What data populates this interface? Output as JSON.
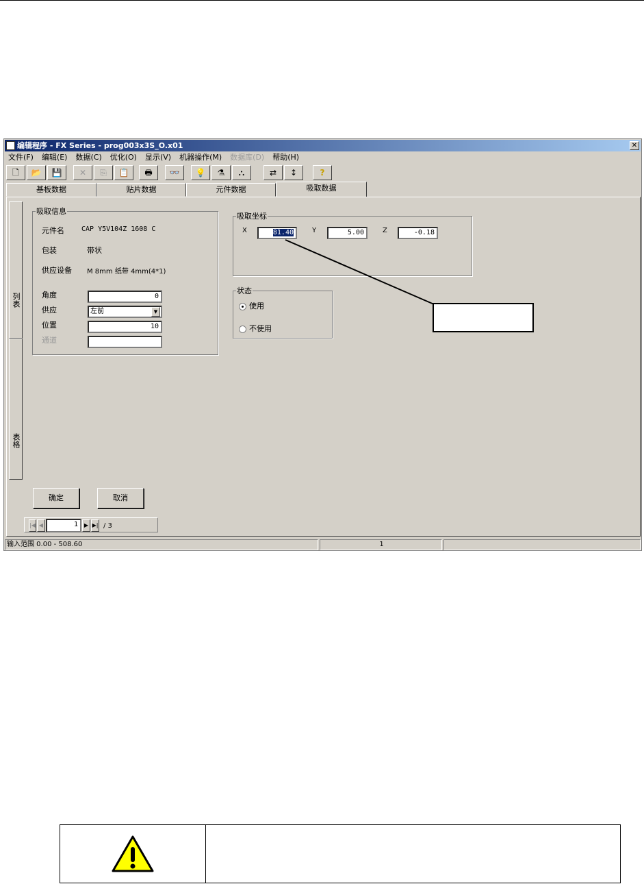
{
  "window": {
    "title": "编辑程序 - FX Series - prog003x3S_O.x01",
    "close": "✕"
  },
  "menu": [
    {
      "label": "文件(F)"
    },
    {
      "label": "编辑(E)"
    },
    {
      "label": "数据(C)"
    },
    {
      "label": "优化(O)"
    },
    {
      "label": "显示(V)"
    },
    {
      "label": "机器操作(M)"
    },
    {
      "label": "数据库(D)",
      "disabled": true
    },
    {
      "label": "帮助(H)"
    }
  ],
  "toolbar": [
    "new",
    "open",
    "save",
    "cut",
    "copy",
    "paste",
    "print",
    "find",
    "idea",
    "optimize",
    "components",
    "swap",
    "align",
    "help"
  ],
  "toolbar_glyphs": {
    "new": "🗋",
    "open": "📂",
    "save": "💾",
    "cut": "✕",
    "copy": "⎘",
    "paste": "📋",
    "print": "🖶",
    "find": "👓",
    "idea": "💡",
    "optimize": "⚗",
    "components": "⛬",
    "swap": "⇄",
    "align": "↕",
    "help": "?"
  },
  "tabs": [
    "基板数据",
    "贴片数据",
    "元件数据",
    "吸取数据"
  ],
  "side_tabs": [
    "列表",
    "表格"
  ],
  "pickup_info": {
    "legend": "吸取信息",
    "part_name_label": "元件名",
    "part_name": "CAP Y5V104Z 1608 C",
    "package_label": "包装",
    "package": "带状",
    "feeder_label": "供应设备",
    "feeder": "M 8mm 纸带 4mm(4*1)",
    "angle_label": "角度",
    "angle": "0",
    "supply_label": "供应",
    "supply": "左前",
    "position_label": "位置",
    "position": "10",
    "channel_label": "通道",
    "channel": ""
  },
  "pickup_coords": {
    "legend": "吸取坐标",
    "x_label": "X",
    "x": "81.40",
    "y_label": "Y",
    "y": "5.00",
    "z_label": "Z",
    "z": "-0.18"
  },
  "state": {
    "legend": "状态",
    "use": "使用",
    "not_use": "不使用"
  },
  "buttons": {
    "ok": "确定",
    "cancel": "取消"
  },
  "nav": {
    "page": "1",
    "total": "/ 3"
  },
  "status": {
    "range": "输入范围 0.00 - 508.60",
    "count": "1",
    "extra": ""
  }
}
